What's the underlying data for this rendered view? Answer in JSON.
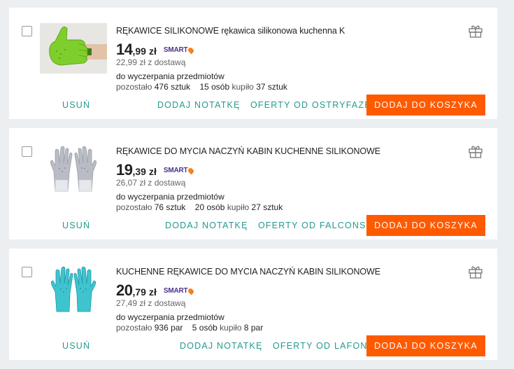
{
  "colors": {
    "accent_link": "#239a8d",
    "cart_button": "#ff5a00",
    "smart_badge": "#4b2f8c",
    "smart_pin": "#f5811f",
    "background": "#eceff1"
  },
  "items": [
    {
      "title": "RĘKAWICE SILIKONOWE rękawica silikonowa kuchenna K",
      "price_int": "14",
      "price_dec": ",99",
      "currency": "zł",
      "smart_label": "SMART",
      "delivery": "22,99 zł z dostawą",
      "stock_note": "do wyczerpania przedmiotów",
      "remaining_label": "pozostało",
      "remaining_value": "476 sztuk",
      "buyers_value": "15 osób",
      "bought_label": "kupiło",
      "bought_value": "37 sztuk",
      "remove_label": "USUŃ",
      "note_label": "DODAJ NOTATKĘ",
      "offers_label": "OFERTY OD OSTRYFAZER",
      "cart_label": "DODAJ DO KOSZYKA",
      "image_icon": "green-silicone-glove-thumbs-up"
    },
    {
      "title": "RĘKAWICE DO MYCIA NACZYŃ KABIN KUCHENNE SILIKONOWE",
      "price_int": "19",
      "price_dec": ",39",
      "currency": "zł",
      "smart_label": "SMART",
      "delivery": "26,07 zł z dostawą",
      "stock_note": "do wyczerpania przedmiotów",
      "remaining_label": "pozostało",
      "remaining_value": "76 sztuk",
      "buyers_value": "20 osób",
      "bought_label": "kupiło",
      "bought_value": "27 sztuk",
      "remove_label": "USUŃ",
      "note_label": "DODAJ NOTATKĘ",
      "offers_label": "OFERTY OD FALCONSM",
      "cart_label": "DODAJ DO KOSZYKA",
      "image_icon": "grey-silicone-gloves-pair"
    },
    {
      "title": "KUCHENNE RĘKAWICE DO MYCIA NACZYŃ KABIN SILIKONOWE",
      "price_int": "20",
      "price_dec": ",79",
      "currency": "zł",
      "smart_label": "SMART",
      "delivery": "27,49 zł z dostawą",
      "stock_note": "do wyczerpania przedmiotów",
      "remaining_label": "pozostało",
      "remaining_value": "936 par",
      "buyers_value": "5 osób",
      "bought_label": "kupiło",
      "bought_value": "8 par",
      "remove_label": "USUŃ",
      "note_label": "DODAJ NOTATKĘ",
      "offers_label": "OFERTY OD LAFONT",
      "cart_label": "DODAJ DO KOSZYKA",
      "image_icon": "turquoise-silicone-gloves-pair"
    }
  ]
}
